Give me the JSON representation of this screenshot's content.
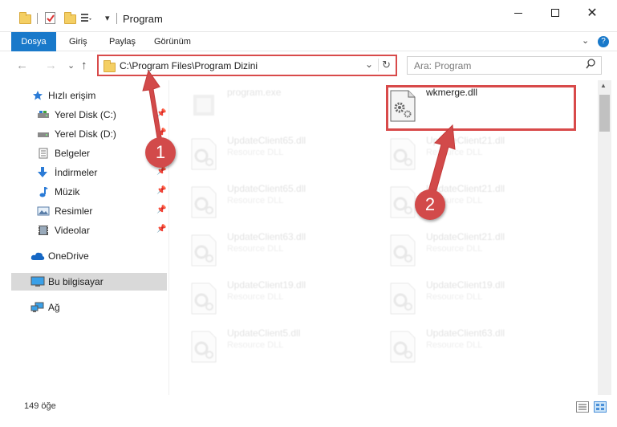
{
  "window": {
    "title": "Program",
    "minimize": "—",
    "maximize": "☐",
    "close": "✕"
  },
  "ribbon": {
    "tabs": [
      "Dosya",
      "Giriş",
      "Paylaş",
      "Görünüm"
    ],
    "expand": "⌄",
    "help": "?"
  },
  "nav": {
    "back": "←",
    "forward": "→",
    "recent": "⌄",
    "up": "↑",
    "address_path": "C:\\Program Files\\Program Dizini",
    "address_dropdown": "⌄",
    "refresh": "↻",
    "search_placeholder": "Ara: Program",
    "search_icon": "⌕"
  },
  "sidebar": {
    "items": [
      {
        "label": "Hızlı erişim",
        "icon": "star-icon",
        "pinned": false
      },
      {
        "label": "Yerel Disk (C:)",
        "icon": "drive-icon",
        "pinned": true
      },
      {
        "label": "Yerel Disk (D:)",
        "icon": "drive-icon",
        "pinned": true
      },
      {
        "label": "Belgeler",
        "icon": "documents-icon",
        "pinned": true
      },
      {
        "label": "İndirmeler",
        "icon": "download-icon",
        "pinned": true
      },
      {
        "label": "Müzik",
        "icon": "music-icon",
        "pinned": true
      },
      {
        "label": "Resimler",
        "icon": "pictures-icon",
        "pinned": true
      },
      {
        "label": "Videolar",
        "icon": "videos-icon",
        "pinned": true
      },
      {
        "label": "OneDrive",
        "icon": "cloud-icon",
        "pinned": false
      },
      {
        "label": "Bu bilgisayar",
        "icon": "computer-icon",
        "pinned": false,
        "selected": true
      },
      {
        "label": "Ağ",
        "icon": "network-icon",
        "pinned": false
      }
    ],
    "pin_glyph": "📌"
  },
  "files": {
    "highlighted": {
      "name": "wkmerge.dll",
      "type": ""
    },
    "left_column": [
      {
        "name": "program.exe",
        "type": ""
      },
      {
        "name": "UpdateClient65.dll",
        "type": "Resource DLL"
      },
      {
        "name": "UpdateClient65.dll",
        "type": "Resource DLL"
      },
      {
        "name": "UpdateClient63.dll",
        "type": "Resource DLL"
      },
      {
        "name": "UpdateClient19.dll",
        "type": "Resource DLL"
      },
      {
        "name": "UpdateClient5.dll",
        "type": "Resource DLL"
      }
    ],
    "right_column": [
      {
        "name": "UpdateClient21.dll",
        "type": "Resource DLL"
      },
      {
        "name": "UpdateClient21.dll",
        "type": "Resource DLL"
      },
      {
        "name": "UpdateClient21.dll",
        "type": "Resource DLL"
      },
      {
        "name": "UpdateClient19.dll",
        "type": "Resource DLL"
      },
      {
        "name": "UpdateClient63.dll",
        "type": "Resource DLL"
      }
    ]
  },
  "status": {
    "count": "149 öğe"
  },
  "annotations": {
    "step1": "1",
    "step2": "2",
    "color": "#d24a4a"
  },
  "colors": {
    "accent": "#1979ca",
    "highlight": "#d84a4a",
    "selected_bg": "#d9d9d9"
  }
}
